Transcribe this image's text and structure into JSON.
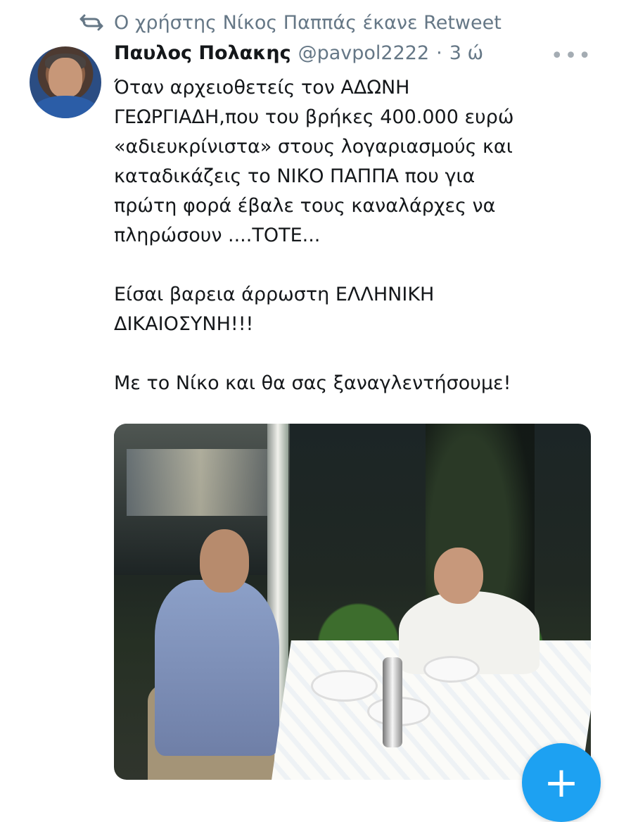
{
  "retweet": {
    "text": "Ο χρήστης Νίκος Παππάς έκανε Retweet",
    "icon": "retweet-icon"
  },
  "tweet": {
    "author_name": "Παυλος Πολακης",
    "handle": "@pavpol2222",
    "separator": "·",
    "time": "3 ώ",
    "more_icon": "more-icon",
    "body": "Όταν αρχειοθετείς τον ΑΔΩΝΗ\nΓΕΩΡΓΙΑΔΗ,που του βρήκες 400.000 ευρώ\n«αδιευκρίνιστα» στους λογαριασμούς και\nκαταδικάζεις το ΝΙΚΟ ΠΑΠΠΑ που για\nπρώτη φορά έβαλε τους καναλάρχες να\nπληρώσουν ....ΤΟΤΕ...\n\nΕίσαι βαρεια άρρωστη ΕΛΛΗΝΙΚΗ\nΔΙΚΑΙΟΣΥΝΗ!!!\n\nΜε το Νίκο και θα σας ξαναγλεντήσουμε!"
  },
  "media": {
    "icon": "photo-icon"
  },
  "fab": {
    "label": "+"
  },
  "colors": {
    "muted": "#657786",
    "accent": "#1da1f2",
    "text": "#14171a"
  }
}
